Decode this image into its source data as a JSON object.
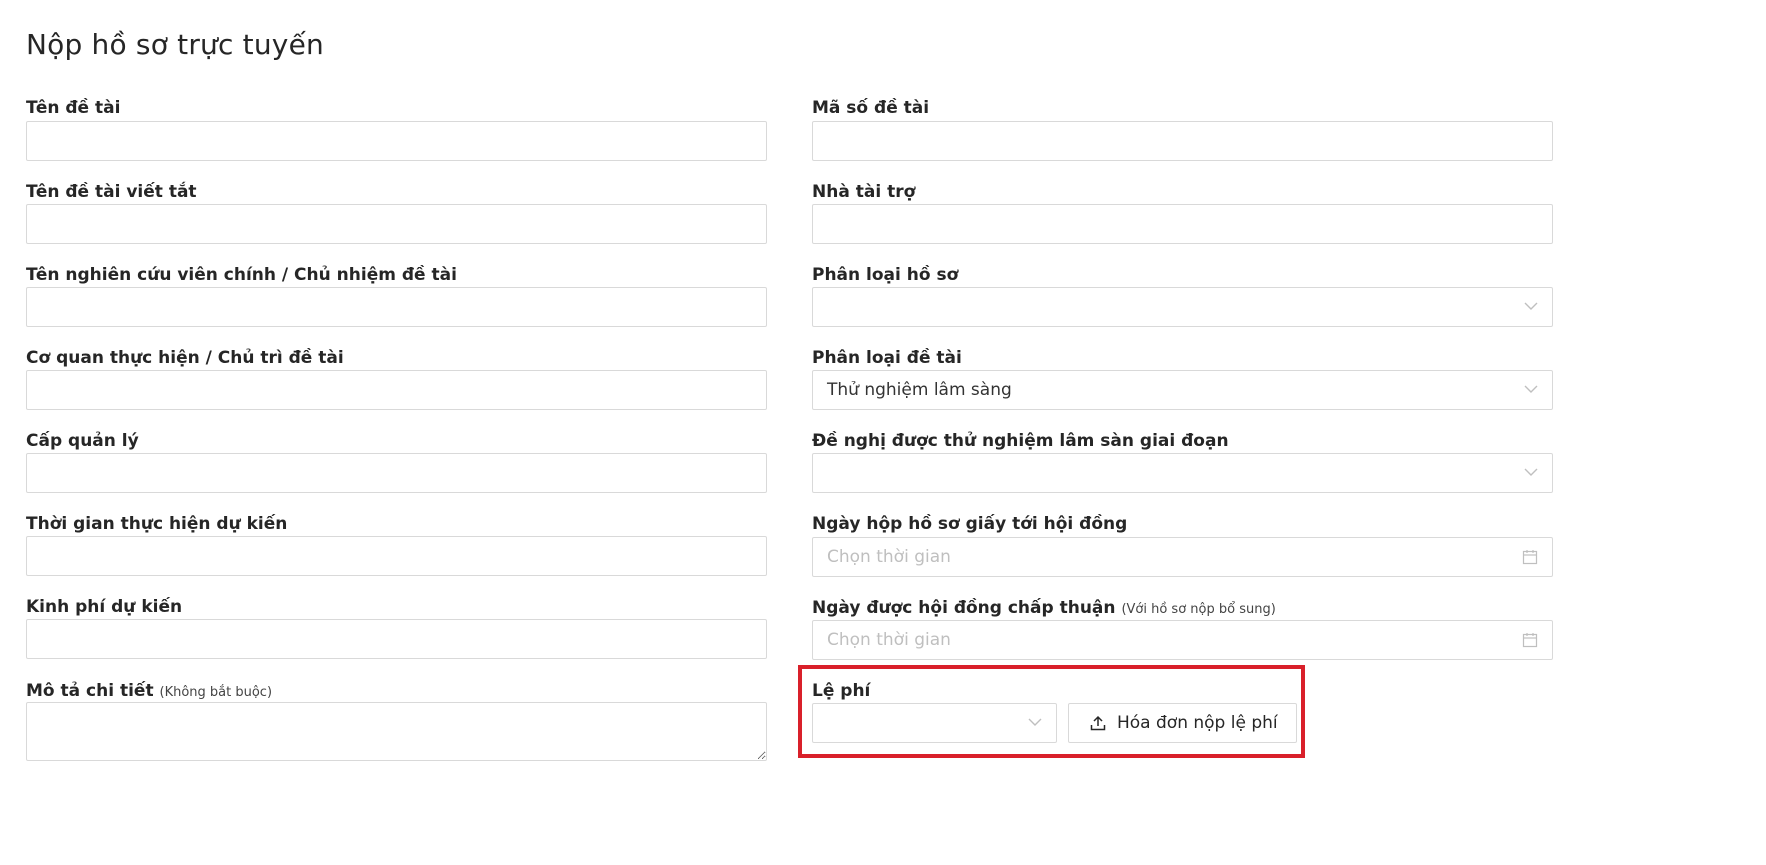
{
  "page": {
    "title": "Nộp hồ sơ trực tuyến"
  },
  "left_fields": [
    {
      "label": "Tên đề tài",
      "value": ""
    },
    {
      "label": "Tên đề tài viết tắt",
      "value": ""
    },
    {
      "label": "Tên nghiên cứu viên chính / Chủ nhiệm đề tài",
      "value": ""
    },
    {
      "label": "Cơ quan thực hiện / Chủ trì đề tài",
      "value": ""
    },
    {
      "label": "Cấp quản lý",
      "value": ""
    },
    {
      "label": "Thời gian thực hiện dự kiến",
      "value": ""
    },
    {
      "label": "Kinh phí dự kiến",
      "value": ""
    }
  ],
  "description": {
    "label": "Mô tả chi tiết",
    "hint": "(Không bắt buộc)",
    "value": ""
  },
  "right_fields": {
    "project_code": {
      "label": "Mã số đề tài",
      "value": ""
    },
    "sponsor": {
      "label": "Nhà tài trợ",
      "value": ""
    },
    "dossier_type": {
      "label": "Phân loại hồ sơ",
      "selected": ""
    },
    "project_type": {
      "label": "Phân loại đề tài",
      "selected": "Thử nghiệm lâm sàng"
    },
    "trial_phase": {
      "label": "Đề nghị được thử nghiệm lâm sàn giai đoạn",
      "selected": ""
    },
    "paper_submit_date": {
      "label": "Ngày hộp hồ sơ giấy tới hội đồng",
      "placeholder": "Chọn thời gian"
    },
    "approval_date": {
      "label": "Ngày được hội đồng chấp thuận",
      "hint": "(Với hồ sơ nộp bổ sung)",
      "placeholder": "Chọn thời gian"
    }
  },
  "fee": {
    "label": "Lệ phí",
    "selected": "",
    "upload_label": "Hóa đơn nộp lệ phí"
  },
  "colors": {
    "highlight": "#d9202a",
    "border": "#d9d9d9",
    "placeholder": "#bfbfbf"
  }
}
